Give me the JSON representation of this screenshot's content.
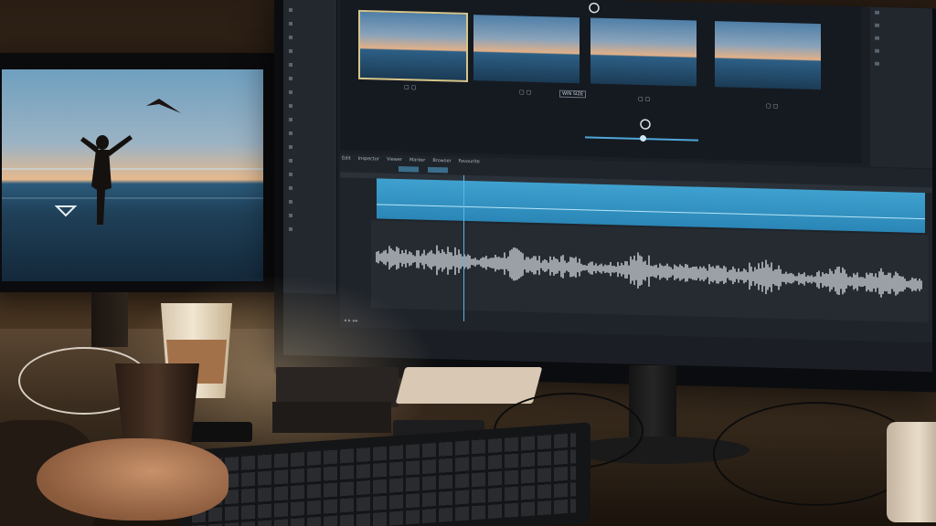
{
  "scene": "photo of a video-editing workstation with two monitors",
  "left_monitor": {
    "content": "beach-sunset-still",
    "icons": [
      "boomerang-icon",
      "chevron-down-icon"
    ]
  },
  "editor": {
    "side_panel_rows": 18,
    "thumbnails": [
      {
        "selected": true
      },
      {
        "selected": false,
        "tag": "WIN SIZE"
      },
      {
        "selected": false
      },
      {
        "selected": false
      }
    ],
    "timeline_menu": [
      "Edit",
      "Inspector",
      "Viewer",
      "Marker",
      "Browser",
      "Favourite"
    ],
    "colors": {
      "video_track": "#2f94c4",
      "waveform": "#e8eef2",
      "panel": "#1b1f25",
      "accent": "#4fa7d9"
    }
  }
}
